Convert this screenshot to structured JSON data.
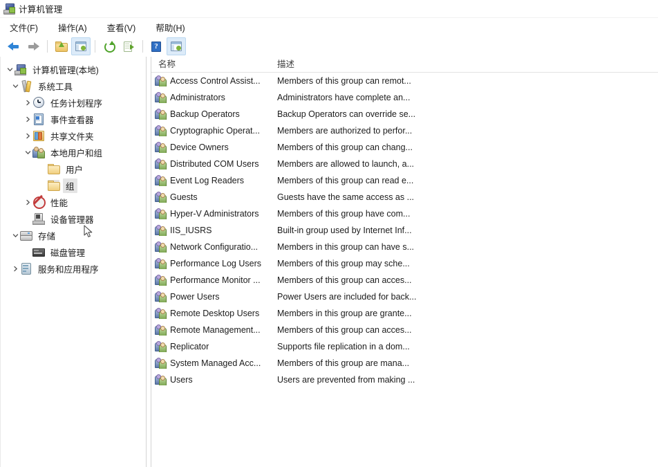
{
  "window": {
    "title": "计算机管理",
    "icon": "computer-management-icon"
  },
  "menubar": {
    "items": [
      {
        "label": "文件(F)",
        "name": "menu-file"
      },
      {
        "label": "操作(A)",
        "name": "menu-action"
      },
      {
        "label": "查看(V)",
        "name": "menu-view"
      },
      {
        "label": "帮助(H)",
        "name": "menu-help"
      }
    ]
  },
  "toolbar": {
    "buttons": [
      {
        "name": "back-icon",
        "active": false
      },
      {
        "name": "forward-icon",
        "active": false
      },
      {
        "name": "up-folder-icon",
        "active": false
      },
      {
        "name": "show-hide-console-tree-icon",
        "active": true
      },
      {
        "name": "refresh-icon",
        "active": false
      },
      {
        "name": "export-list-icon",
        "active": false
      },
      {
        "name": "help-icon",
        "active": false
      },
      {
        "name": "show-hide-action-pane-icon",
        "active": true
      }
    ]
  },
  "tree": {
    "nodes": [
      {
        "label": "计算机管理(本地)",
        "icon": "computer-management-icon",
        "indent": 0,
        "twisty": "expanded",
        "selected": false
      },
      {
        "label": "系统工具",
        "icon": "system-tools-icon",
        "indent": 1,
        "twisty": "expanded",
        "selected": false
      },
      {
        "label": "任务计划程序",
        "icon": "task-scheduler-icon",
        "indent": 2,
        "twisty": "collapsed",
        "selected": false
      },
      {
        "label": "事件查看器",
        "icon": "event-viewer-icon",
        "indent": 2,
        "twisty": "collapsed",
        "selected": false
      },
      {
        "label": "共享文件夹",
        "icon": "shared-folders-icon",
        "indent": 2,
        "twisty": "collapsed",
        "selected": false
      },
      {
        "label": "本地用户和组",
        "icon": "local-users-groups-icon",
        "indent": 2,
        "twisty": "expanded",
        "selected": false
      },
      {
        "label": "用户",
        "icon": "folder-icon",
        "indent": 3,
        "twisty": "none",
        "selected": false
      },
      {
        "label": "组",
        "icon": "folder-icon",
        "indent": 3,
        "twisty": "none",
        "selected": true
      },
      {
        "label": "性能",
        "icon": "performance-icon",
        "indent": 2,
        "twisty": "collapsed",
        "selected": false
      },
      {
        "label": "设备管理器",
        "icon": "device-manager-icon",
        "indent": 2,
        "twisty": "none",
        "selected": false
      },
      {
        "label": "存储",
        "icon": "storage-icon",
        "indent": 1,
        "twisty": "expanded",
        "selected": false
      },
      {
        "label": "磁盘管理",
        "icon": "disk-management-icon",
        "indent": 2,
        "twisty": "none",
        "selected": false
      },
      {
        "label": "服务和应用程序",
        "icon": "services-applications-icon",
        "indent": 1,
        "twisty": "collapsed",
        "selected": false
      }
    ]
  },
  "list": {
    "columns": [
      {
        "label": "名称",
        "name": "column-header-name"
      },
      {
        "label": "描述",
        "name": "column-header-description"
      }
    ],
    "rows": [
      {
        "name": "Access Control Assist...",
        "desc": "Members of this group can remot..."
      },
      {
        "name": "Administrators",
        "desc": "Administrators have complete an..."
      },
      {
        "name": "Backup Operators",
        "desc": "Backup Operators can override se..."
      },
      {
        "name": "Cryptographic Operat...",
        "desc": "Members are authorized to perfor..."
      },
      {
        "name": "Device Owners",
        "desc": "Members of this group can chang..."
      },
      {
        "name": "Distributed COM Users",
        "desc": "Members are allowed to launch, a..."
      },
      {
        "name": "Event Log Readers",
        "desc": "Members of this group can read e..."
      },
      {
        "name": "Guests",
        "desc": "Guests have the same access as ..."
      },
      {
        "name": "Hyper-V Administrators",
        "desc": "Members of this group have com..."
      },
      {
        "name": "IIS_IUSRS",
        "desc": "Built-in group used by Internet Inf..."
      },
      {
        "name": "Network Configuratio...",
        "desc": "Members in this group can have s..."
      },
      {
        "name": "Performance Log Users",
        "desc": "Members of this group may sche..."
      },
      {
        "name": "Performance Monitor ...",
        "desc": "Members of this group can acces..."
      },
      {
        "name": "Power Users",
        "desc": "Power Users are included for back..."
      },
      {
        "name": "Remote Desktop Users",
        "desc": "Members in this group are grante..."
      },
      {
        "name": "Remote Management...",
        "desc": "Members of this group can acces..."
      },
      {
        "name": "Replicator",
        "desc": "Supports file replication in a dom..."
      },
      {
        "name": "System Managed Acc...",
        "desc": "Members of this group are mana..."
      },
      {
        "name": "Users",
        "desc": "Users are prevented from making ..."
      }
    ]
  },
  "colors": {
    "selection": "#e4e4e4",
    "toolbar_active": "#dcebf9",
    "text": "#1b1b1b",
    "header_text": "#3f3f3f"
  }
}
